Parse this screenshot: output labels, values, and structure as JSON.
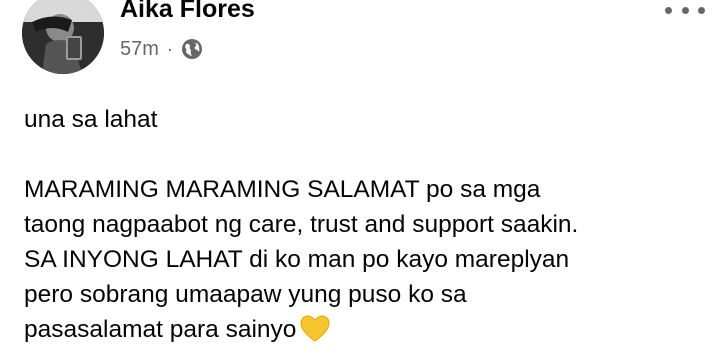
{
  "post": {
    "author": "Aika Flores",
    "timestamp": "57m",
    "separator": "·",
    "privacy_icon": "globe-icon",
    "lines": [
      "una sa lahat",
      "MARAMING MARAMING SALAMAT po sa mga",
      "taong nagpaabot ng care, trust and support saakin.",
      "SA INYONG LAHAT di ko man po kayo mareplyan",
      "pero sobrang umaapaw yung puso ko sa",
      "pasasalamat para sainyo"
    ],
    "emoji": "yellow-heart-icon"
  },
  "colors": {
    "text": "#050505",
    "secondary": "#65676b",
    "heart": "#f7c52e"
  }
}
